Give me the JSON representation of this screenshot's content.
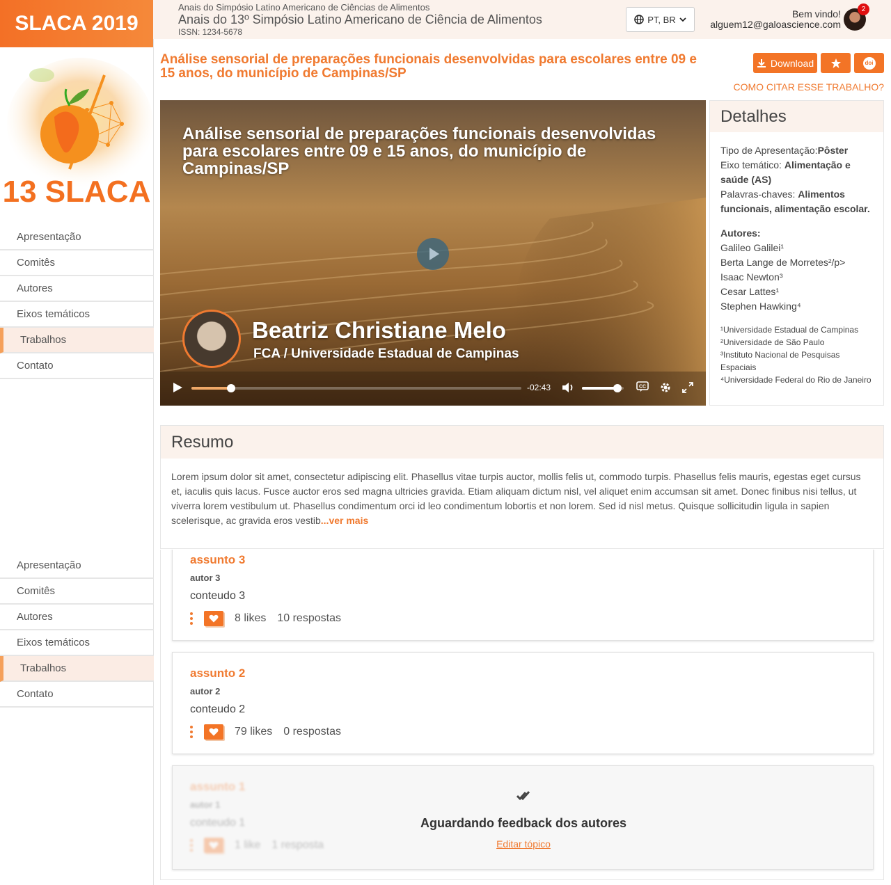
{
  "brand": {
    "name": "SLACA 2019",
    "logo_text": "13 SLACA"
  },
  "publication": {
    "line1": "Anais do Simpósio Latino Americano de Ciências de Alimentos",
    "line2": "Anais do 13º Simpósio Latino Americano de Ciência de Alimentos",
    "issn": "ISSN: 1234-5678"
  },
  "language": {
    "label": "PT, BR"
  },
  "user": {
    "greeting": "Bem vindo!",
    "email": "alguem12@galoascience.com",
    "notifications": "2"
  },
  "nav": {
    "items": [
      "Apresentação",
      "Comitês",
      "Autores",
      "Eixos temáticos",
      "Trabalhos",
      "Contato"
    ],
    "active": "Trabalhos"
  },
  "work": {
    "title": "Análise sensorial de preparações funcionais desenvolvidas para escolares entre 09 e 15 anos, do município de Campinas/SP",
    "download_label": "Download",
    "doi_label": "doi",
    "cite_label": "COMO CITAR ESSE TRABALHO?"
  },
  "video": {
    "title": "Análise sensorial de preparações funcionais desenvolvidas para escolares entre 09 e 15 anos, do município de Campinas/SP",
    "speaker": "Beatriz Christiane Melo",
    "affiliation": "FCA / Universidade Estadual de Campinas",
    "time_remaining": "-02:43",
    "progress": 0.12,
    "volume": 0.85
  },
  "details": {
    "heading": "Detalhes",
    "type_label": "Tipo de Apresentação:",
    "type_value": "Pôster",
    "axis_label": "Eixo temático:",
    "axis_value": "Alimentação e saúde (AS)",
    "keywords_label": "Palavras-chaves:",
    "keywords_value": "Alimentos funcionais, alimentação escolar.",
    "authors_label": "Autores:",
    "authors": [
      "Galileo Galilei¹",
      "Berta Lange de Morretes²/p>",
      "Isaac Newton³",
      "Cesar Lattes¹",
      "Stephen Hawking⁴"
    ],
    "affiliations": [
      "¹Universidade Estadual de Campinas",
      "²Universidade de São Paulo",
      "³Instituto Nacional de Pesquisas Espaciais",
      "⁴Universidade Federal do Rio de Janeiro"
    ]
  },
  "resumo": {
    "heading": "Resumo",
    "text": "Lorem ipsum dolor sit amet, consectetur adipiscing elit. Phasellus vitae turpis auctor, mollis felis ut, commodo turpis. Phasellus felis mauris, egestas eget cursus et, iaculis quis lacus. Fusce auctor eros sed magna ultricies gravida. Etiam aliquam dictum nisl, vel aliquet enim accumsan sit amet. Donec finibus nisi tellus, ut viverra lorem vestibulum ut. Phasellus condimentum orci id leo condimentum lobortis et non lorem. Sed id nisl metus. Quisque sollicitudin ligula in sapien scelerisque, ac gravida eros vestib",
    "more": "...ver mais"
  },
  "topics": [
    {
      "subject": "assunto 3",
      "author": "autor 3",
      "content": "conteudo 3",
      "likes": "8 likes",
      "replies": "10 respostas"
    },
    {
      "subject": "assunto 2",
      "author": "autor 2",
      "content": "conteudo 2",
      "likes": "79 likes",
      "replies": "0 respostas"
    },
    {
      "subject": "assunto 1",
      "author": "autor 1",
      "content": "conteudo 1",
      "likes": "1 like",
      "replies": "1 resposta"
    }
  ],
  "pending": {
    "message": "Aguardando feedback dos autores",
    "edit_label": "Editar tópico"
  },
  "colors": {
    "accent": "#f37426",
    "header_bg": "#fbf2ec",
    "active_nav": "#fbece4"
  }
}
